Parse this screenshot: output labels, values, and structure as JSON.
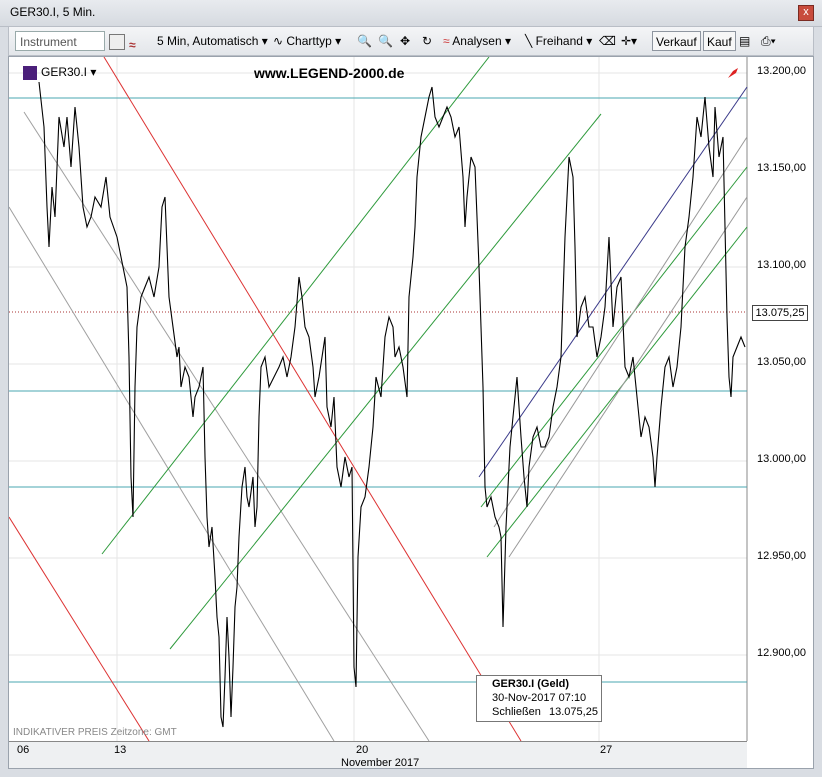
{
  "window": {
    "title": "GER30.I, 5 Min.",
    "close": "x"
  },
  "toolbar": {
    "instrument_placeholder": "Instrument",
    "interval": "5 Min,  Automatisch",
    "charttype": "Charttyp",
    "analysen": "Analysen",
    "freihand": "Freihand",
    "verkauf": "Verkauf",
    "kauf": "Kauf"
  },
  "chart": {
    "symbol": "GER30.I",
    "brand": "www.LEGEND-2000.de",
    "current_price": "13.075,25",
    "indicative": "INDIKATIVER PREIS   Zeitzone: GMT",
    "month": "November 2017",
    "x_ticks": [
      "06",
      "13",
      "20",
      "27"
    ],
    "y_ticks": [
      "13.200,00",
      "13.150,00",
      "13.100,00",
      "13.050,00",
      "13.000,00",
      "12.950,00",
      "12.900,00"
    ],
    "info": {
      "title": "GER30.I (Geld)",
      "date": "30-Nov-2017 07:10",
      "label": "Schließen",
      "value": "13.075,25"
    }
  },
  "colors": {
    "cyan": "#4aa7b0",
    "green": "#2e9a3c",
    "red": "#d33",
    "gray": "#999",
    "navy": "#3a3a8a"
  }
}
